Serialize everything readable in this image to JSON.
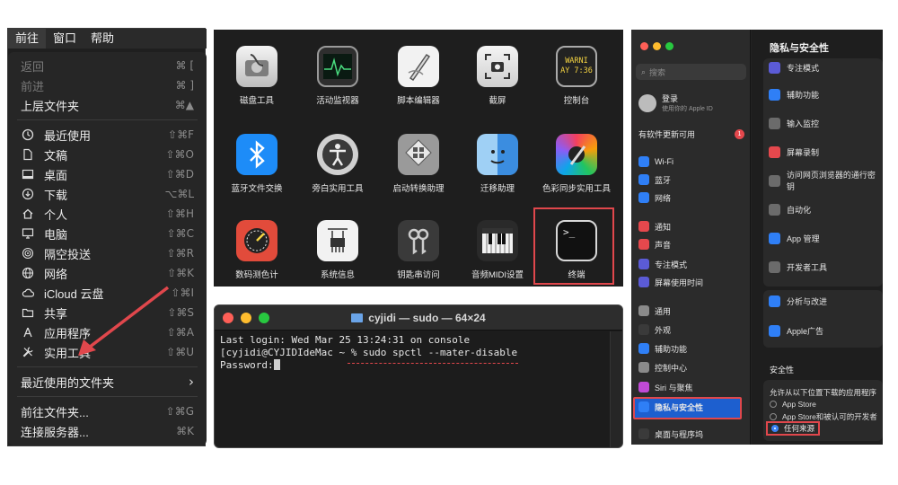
{
  "finder": {
    "menubar": [
      "前往",
      "窗口",
      "帮助"
    ],
    "items": [
      {
        "label": "返回",
        "shortcut": "⌘ [",
        "icon": "none",
        "dim": true
      },
      {
        "label": "前进",
        "shortcut": "⌘ ]",
        "icon": "none",
        "dim": true
      },
      {
        "label": "上层文件夹",
        "shortcut": "⌘▲",
        "icon": "none"
      },
      {
        "label": "最近使用",
        "shortcut": "⇧⌘F",
        "icon": "clock-icon"
      },
      {
        "label": "文稿",
        "shortcut": "⇧⌘O",
        "icon": "document-icon"
      },
      {
        "label": "桌面",
        "shortcut": "⇧⌘D",
        "icon": "desktop-icon"
      },
      {
        "label": "下载",
        "shortcut": "⌥⌘L",
        "icon": "download-icon"
      },
      {
        "label": "个人",
        "shortcut": "⇧⌘H",
        "icon": "home-icon"
      },
      {
        "label": "电脑",
        "shortcut": "⇧⌘C",
        "icon": "computer-icon"
      },
      {
        "label": "隔空投送",
        "shortcut": "⇧⌘R",
        "icon": "airdrop-icon"
      },
      {
        "label": "网络",
        "shortcut": "⇧⌘K",
        "icon": "network-icon"
      },
      {
        "label": "iCloud 云盘",
        "shortcut": "⇧⌘I",
        "icon": "cloud-icon"
      },
      {
        "label": "共享",
        "shortcut": "⇧⌘S",
        "icon": "shared-folder-icon"
      },
      {
        "label": "应用程序",
        "shortcut": "⇧⌘A",
        "icon": "applications-icon"
      },
      {
        "label": "实用工具",
        "shortcut": "⇧⌘U",
        "icon": "tools-icon"
      },
      {
        "label": "最近使用的文件夹",
        "shortcut": "›",
        "icon": "none"
      },
      {
        "label": "前往文件夹...",
        "shortcut": "⇧⌘G",
        "icon": "none"
      },
      {
        "label": "连接服务器...",
        "shortcut": "⌘K",
        "icon": "none"
      }
    ]
  },
  "utilities": {
    "apps": [
      {
        "name": "磁盘工具",
        "icon": "disk-utility-icon"
      },
      {
        "name": "活动监视器",
        "icon": "activity-monitor-icon"
      },
      {
        "name": "脚本编辑器",
        "icon": "script-editor-icon"
      },
      {
        "name": "截屏",
        "icon": "screenshot-icon"
      },
      {
        "name": "控制台",
        "icon": "console-icon",
        "glyph": "WARNI\nAY 7:36"
      },
      {
        "name": "蓝牙文件交换",
        "icon": "bluetooth-icon"
      },
      {
        "name": "旁白实用工具",
        "icon": "voiceover-icon"
      },
      {
        "name": "启动转换助理",
        "icon": "boot-camp-icon"
      },
      {
        "name": "迁移助理",
        "icon": "migration-assistant-icon"
      },
      {
        "name": "色彩同步实用工具",
        "icon": "colorsync-icon"
      },
      {
        "name": "数码测色计",
        "icon": "color-meter-icon"
      },
      {
        "name": "系统信息",
        "icon": "system-information-icon"
      },
      {
        "name": "钥匙串访问",
        "icon": "keychain-icon"
      },
      {
        "name": "音频MIDI设置",
        "icon": "midi-icon"
      },
      {
        "name": "终端",
        "icon": "terminal-icon",
        "glyph": ">_"
      }
    ]
  },
  "terminal": {
    "title": "cyjidi — sudo — 64×24",
    "lines": [
      "Last login: Wed Mar 25 13:24:31 on console",
      "[cyjidi@CYJIDIdeMac ~ % sudo spctl --mater-disable",
      "Password:"
    ]
  },
  "settings": {
    "signin_title": "登录",
    "signin_sub": "使用你的 Apple ID",
    "update_label": "有软件更新可用",
    "update_badge": "1",
    "search_placeholder": "搜索",
    "sidebar": [
      {
        "label": "Wi-Fi",
        "color": "#2f7ff6"
      },
      {
        "label": "蓝牙",
        "color": "#2f7ff6"
      },
      {
        "label": "网络",
        "color": "#2f7ff6"
      },
      {
        "label": "通知",
        "color": "#e5484d"
      },
      {
        "label": "声音",
        "color": "#e5484d"
      },
      {
        "label": "专注模式",
        "color": "#5b5bd6"
      },
      {
        "label": "屏幕使用时间",
        "color": "#5b5bd6"
      },
      {
        "label": "通用",
        "color": "#8a8a8a"
      },
      {
        "label": "外观",
        "color": "#3a3a3a"
      },
      {
        "label": "辅助功能",
        "color": "#2f7ff6"
      },
      {
        "label": "控制中心",
        "color": "#8a8a8a"
      },
      {
        "label": "Siri 与聚焦",
        "color": "#c04ad6"
      },
      {
        "label": "隐私与安全性",
        "color": "#2f7ff6"
      },
      {
        "label": "桌面与程序坞",
        "color": "#3a3a3a"
      }
    ],
    "main_title": "隐私与安全性",
    "main_rows_a": [
      {
        "label": "专注模式",
        "color": "#5b5bd6"
      },
      {
        "label": "辅助功能",
        "color": "#2f7ff6"
      },
      {
        "label": "输入监控",
        "color": "#6b6b6b"
      },
      {
        "label": "屏幕录制",
        "color": "#e5484d"
      },
      {
        "label": "访问网页浏览器的通行密钥",
        "color": "#6b6b6b"
      },
      {
        "label": "自动化",
        "color": "#6b6b6b"
      },
      {
        "label": "App 管理",
        "color": "#2f7ff6"
      },
      {
        "label": "开发者工具",
        "color": "#6b6b6b"
      }
    ],
    "main_rows_b": [
      {
        "label": "分析与改进",
        "color": "#2f7ff6"
      },
      {
        "label": "Apple广告",
        "color": "#2f7ff6"
      }
    ],
    "security_header": "安全性",
    "allow_label": "允许从以下位置下载的应用程序",
    "options": [
      "App Store",
      "App Store和被认可的开发者",
      "任何来源"
    ]
  }
}
